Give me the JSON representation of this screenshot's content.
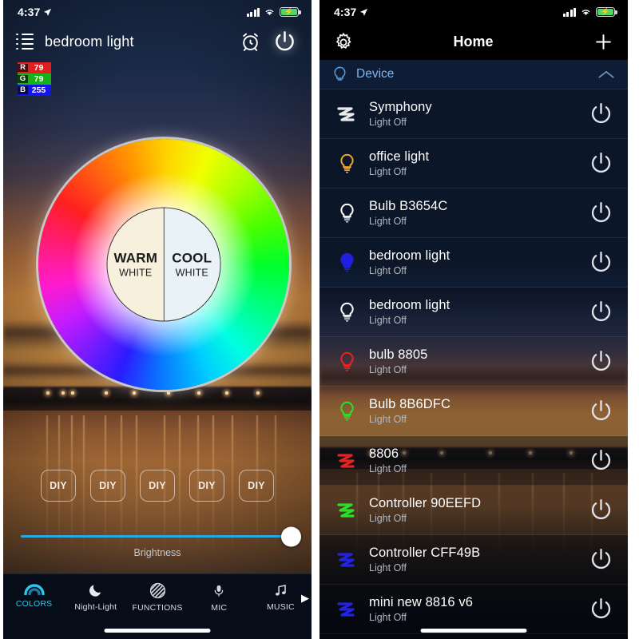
{
  "left": {
    "statusbar": {
      "time": "4:37",
      "location_icon": "location-arrow-icon",
      "signal_icon": "cellular-signal-icon",
      "wifi_icon": "wifi-icon",
      "battery_icon": "battery-charging-icon"
    },
    "header": {
      "menu_icon": "hamburger-list-icon",
      "title": "bedroom light",
      "alarm_icon": "alarm-clock-icon",
      "power_icon": "power-icon"
    },
    "rgb": {
      "r_label": "R",
      "r_value": "79",
      "g_label": "G",
      "g_value": "79",
      "b_label": "B",
      "b_value": "255",
      "r_color": "#e02020",
      "g_color": "#18b218",
      "b_color": "#1414f0"
    },
    "wheel": {
      "warm_big": "WARM",
      "warm_small": "WHITE",
      "cool_big": "COOL",
      "cool_small": "WHITE",
      "picker_name": "color-picker-handle"
    },
    "diy": [
      "DIY",
      "DIY",
      "DIY",
      "DIY",
      "DIY"
    ],
    "brightness": {
      "label": "Brightness",
      "value": 100,
      "track_color": "#2aa9e0"
    },
    "tabs": [
      {
        "label": "COLORS",
        "icon": "rainbow-icon",
        "active": true
      },
      {
        "label": "Night-Light",
        "icon": "moon-icon",
        "active": false
      },
      {
        "label": "FUNCTIONS",
        "icon": "hatched-circle-icon",
        "active": false
      },
      {
        "label": "MIC",
        "icon": "microphone-icon",
        "active": false
      },
      {
        "label": "MUSIC",
        "icon": "music-note-icon",
        "active": false
      }
    ],
    "tab_more_icon": "chevron-right-icon",
    "active_tab_color": "#2ec5e8"
  },
  "right": {
    "statusbar": {
      "time": "4:37",
      "location_icon": "location-arrow-icon",
      "signal_icon": "cellular-signal-icon",
      "wifi_icon": "wifi-icon",
      "battery_icon": "battery-charging-icon"
    },
    "header": {
      "settings_icon": "gear-icon",
      "title": "Home",
      "add_icon": "plus-icon"
    },
    "section": {
      "icon": "bulb-icon",
      "label": "Device",
      "collapse_icon": "chevron-up-icon",
      "label_color": "#7fb6e8"
    },
    "devices": [
      {
        "name": "Symphony",
        "status": "Light Off",
        "icon": "led-strip-icon",
        "color": "#e8eaee"
      },
      {
        "name": "office light",
        "status": "Light Off",
        "icon": "bulb-icon",
        "color": "#f0a32a"
      },
      {
        "name": "Bulb B3654C",
        "status": "Light Off",
        "icon": "bulb-icon",
        "color": "#ffffff"
      },
      {
        "name": "bedroom light",
        "status": "Light Off",
        "icon": "bulb-icon",
        "color": "#1f1fe0"
      },
      {
        "name": "bedroom light",
        "status": "Light Off",
        "icon": "bulb-icon",
        "color": "#ffffff"
      },
      {
        "name": "bulb 8805",
        "status": "Light Off",
        "icon": "bulb-icon",
        "color": "#ef2020"
      },
      {
        "name": "Bulb 8B6DFC",
        "status": "Light Off",
        "icon": "bulb-icon",
        "color": "#2ae02a"
      },
      {
        "name": "8806",
        "status": "Light Off",
        "icon": "led-strip-icon",
        "color": "#e02424"
      },
      {
        "name": "Controller  90EEFD",
        "status": "Light Off",
        "icon": "led-strip-icon",
        "color": "#2ae02a"
      },
      {
        "name": "Controller  CFF49B",
        "status": "Light Off",
        "icon": "led-strip-icon",
        "color": "#2323e8"
      },
      {
        "name": "mini new 8816 v6",
        "status": "Light Off",
        "icon": "led-strip-icon",
        "color": "#2323e8"
      }
    ],
    "power_icon": "power-icon"
  }
}
